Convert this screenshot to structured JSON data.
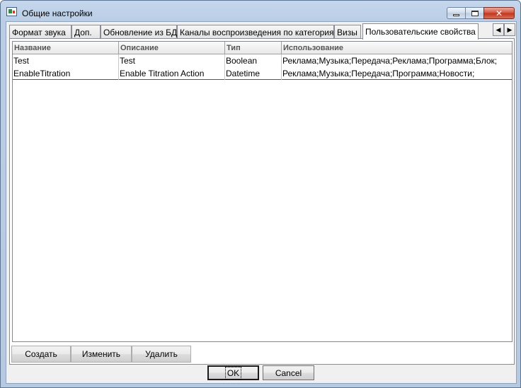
{
  "window": {
    "title": "Общие настройки"
  },
  "caption_buttons": {
    "close_glyph": "✕"
  },
  "tabs": [
    {
      "label": "Формат звука"
    },
    {
      "label": "Доп."
    },
    {
      "label": "Обновление из БД"
    },
    {
      "label": "Каналы воспроизведения по категориям"
    },
    {
      "label": "Визы"
    },
    {
      "label": "Пользовательские свойства",
      "active": true
    }
  ],
  "tab_scroll": {
    "left": "◀",
    "right": "▶"
  },
  "grid": {
    "columns": [
      "Название",
      "Описание",
      "Тип",
      "Использование"
    ],
    "rows": [
      [
        "Test",
        "Test",
        "Boolean",
        "Реклама;Музыка;Передача;Реклама;Программа;Блок;"
      ],
      [
        "EnableTitration",
        "Enable Titration Action",
        "Datetime",
        "Реклама;Музыка;Передача;Программа;Новости;"
      ]
    ]
  },
  "actions": {
    "create": "Создать",
    "edit": "Изменить",
    "delete": "Удалить"
  },
  "dialog": {
    "ok": "OK",
    "cancel": "Cancel"
  }
}
